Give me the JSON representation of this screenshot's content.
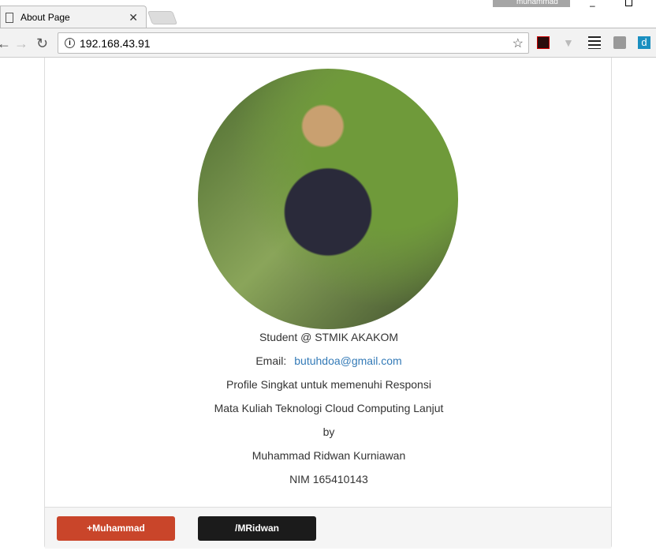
{
  "browser": {
    "user_label": "muhammad",
    "tab_title": "About Page",
    "url": "192.168.43.91"
  },
  "profile": {
    "tagline": "Student @ STMIK AKAKOM",
    "email_label": "Email:",
    "email": "butuhdoa@gmail.com",
    "lines": [
      "Profile Singkat untuk memenuhi Responsi",
      "Mata Kuliah Teknologi Cloud Computing Lanjut",
      "by",
      "Muhammad Ridwan Kurniawan",
      "NIM 165410143"
    ]
  },
  "footer": {
    "google_label": "+Muhammad",
    "github_label": "/MRidwan"
  },
  "colors": {
    "google": "#c9452a",
    "github": "#1b1b1b",
    "link": "#337ab7"
  }
}
